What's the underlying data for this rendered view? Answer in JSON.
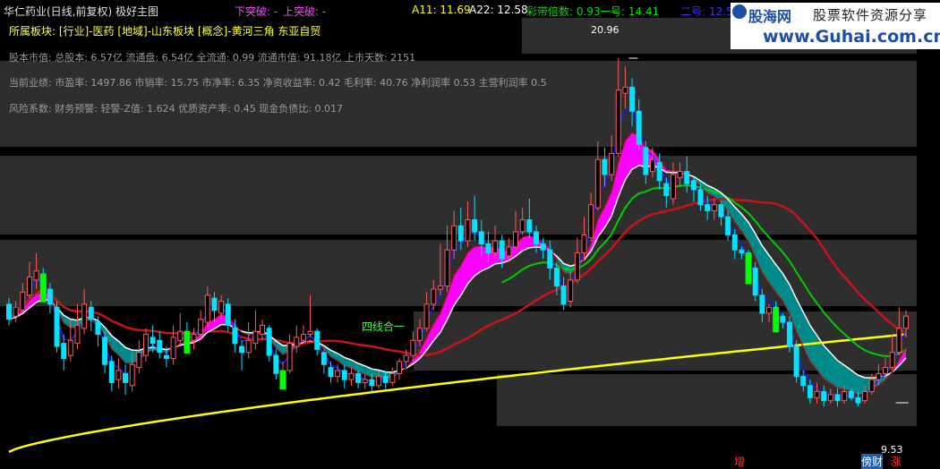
{
  "header": {
    "title": "华仁药业(日线,前复权) 极好主图",
    "break_down": "下突破: -",
    "break_up": "上突破: -",
    "a11": "A11: 11.69",
    "a22": "A22: 12.58",
    "band_mult": "彩带倍数: 0.93",
    "line1": "一号: 14.41",
    "line2": "二号: 12.53"
  },
  "info": {
    "sector": "所属板块: [行业]-医药 [地域]-山东板块 [概念]-黄河三角 东亚自贸",
    "market": "股本市值: 总股本: 6.57亿 流通盘: 6.54亿 全流通: 0.99 流通市值: 91.18亿 上市天数: 2151",
    "perf": "当前业绩: 市盈率: 1497.86 市销率: 15.75 市净率: 6.35 净资收益率: 0.42 毛利率: 40.76 净利润率 0.53 主营利润率 0.5",
    "risk": "风险系数: 财务预警: 轻警-Z值: 1.624 优质资产率: 0.45 现金负债比: 0.017"
  },
  "logo": {
    "name": "股海网",
    "slogan": "股票软件资源分享",
    "url": "www.Guhai.com.cn"
  },
  "annotations": {
    "high": "20.96",
    "low": "9.53",
    "four_lines": "四线合一",
    "zeng": "增",
    "bang": "傍财",
    "zhang": "涨"
  },
  "colors": {
    "up": "#ff5a5a",
    "down": "#00e4ff",
    "ma_fast": "#1a1aff",
    "ma_mid": "#c81414",
    "ma_long": "#ffff00",
    "ma_green": "#00cc00",
    "band_magenta": "#ff00ff",
    "band_teal": "#008b8b",
    "big_green": "#00ff00"
  },
  "candles": [
    [
      12.8,
      12.3,
      13.0,
      12.1
    ],
    [
      12.4,
      12.7,
      12.9,
      12.2
    ],
    [
      12.6,
      13.2,
      13.5,
      12.5
    ],
    [
      13.1,
      13.7,
      14.2,
      13.0
    ],
    [
      13.6,
      13.9,
      14.5,
      13.3
    ],
    [
      13.8,
      13.4,
      14.0,
      13.1
    ],
    [
      13.3,
      12.8,
      13.5,
      12.5
    ],
    [
      12.7,
      11.4,
      12.9,
      11.2
    ],
    [
      11.5,
      11.0,
      11.8,
      10.6
    ],
    [
      11.1,
      11.6,
      12.3,
      10.9
    ],
    [
      11.5,
      12.1,
      12.8,
      11.3
    ],
    [
      12.0,
      12.8,
      13.3,
      11.8
    ],
    [
      12.7,
      12.3,
      12.9,
      11.9
    ],
    [
      12.2,
      11.8,
      12.4,
      11.4
    ],
    [
      11.7,
      10.8,
      11.9,
      10.5
    ],
    [
      10.9,
      10.2,
      11.1,
      9.9
    ],
    [
      10.3,
      10.6,
      11.0,
      10.0
    ],
    [
      10.5,
      10.2,
      10.8,
      9.8
    ],
    [
      10.1,
      10.8,
      11.2,
      9.9
    ],
    [
      10.7,
      11.2,
      11.6,
      10.5
    ],
    [
      11.1,
      11.8,
      12.0,
      10.9
    ],
    [
      11.7,
      11.5,
      12.1,
      11.2
    ],
    [
      11.6,
      11.2,
      11.9,
      11.0
    ],
    [
      11.1,
      11.0,
      11.4,
      10.7
    ],
    [
      11.0,
      11.7,
      12.1,
      10.8
    ],
    [
      11.6,
      11.9,
      12.5,
      11.4
    ],
    [
      11.9,
      11.7,
      12.2,
      11.4
    ],
    [
      11.6,
      11.8,
      12.0,
      11.3
    ],
    [
      11.8,
      12.3,
      12.6,
      11.6
    ],
    [
      12.2,
      13.1,
      13.4,
      12.0
    ],
    [
      13.0,
      12.6,
      13.2,
      12.2
    ],
    [
      12.5,
      12.9,
      13.1,
      12.3
    ],
    [
      12.8,
      12.1,
      13.0,
      11.9
    ],
    [
      12.0,
      11.5,
      12.3,
      11.2
    ],
    [
      11.4,
      11.2,
      11.6,
      10.6
    ],
    [
      11.2,
      11.6,
      12.2,
      11.0
    ],
    [
      11.5,
      11.9,
      12.6,
      11.3
    ],
    [
      11.8,
      12.1,
      12.3,
      11.6
    ],
    [
      12.0,
      11.1,
      12.1,
      10.9
    ],
    [
      11.1,
      10.5,
      11.3,
      10.3
    ],
    [
      10.5,
      10.6,
      10.9,
      10.2
    ],
    [
      10.6,
      11.5,
      11.8,
      10.5
    ],
    [
      11.4,
      11.7,
      12.1,
      11.2
    ],
    [
      11.6,
      11.8,
      12.1,
      11.5
    ],
    [
      11.8,
      11.9,
      13.1,
      11.7
    ],
    [
      11.9,
      11.3,
      12.0,
      11.1
    ],
    [
      11.2,
      10.8,
      11.3,
      10.5
    ],
    [
      10.7,
      10.4,
      10.9,
      10.2
    ],
    [
      10.4,
      10.6,
      10.8,
      10.2
    ],
    [
      10.6,
      10.3,
      10.8,
      10.0
    ],
    [
      10.3,
      10.5,
      10.7,
      10.1
    ],
    [
      10.5,
      10.2,
      10.6,
      10.0
    ],
    [
      10.2,
      10.3,
      10.5,
      10.0
    ],
    [
      10.3,
      10.1,
      10.5,
      9.9
    ],
    [
      10.1,
      10.4,
      10.6,
      10.0
    ],
    [
      10.4,
      10.2,
      10.6,
      10.0
    ],
    [
      10.2,
      10.5,
      10.7,
      10.1
    ],
    [
      10.5,
      10.9,
      11.0,
      10.3
    ],
    [
      10.9,
      11.1,
      11.3,
      10.7
    ],
    [
      11.1,
      11.6,
      11.9,
      10.9
    ],
    [
      11.6,
      12.0,
      12.3,
      11.4
    ],
    [
      12.0,
      12.8,
      13.2,
      11.9
    ],
    [
      12.8,
      13.3,
      13.6,
      12.6
    ],
    [
      13.3,
      13.4,
      14.8,
      13.1
    ],
    [
      13.4,
      14.6,
      15.4,
      13.2
    ],
    [
      14.6,
      15.4,
      15.9,
      14.3
    ],
    [
      15.4,
      14.9,
      16.0,
      14.6
    ],
    [
      14.9,
      15.6,
      16.2,
      14.7
    ],
    [
      15.6,
      15.2,
      16.4,
      14.9
    ],
    [
      15.2,
      14.8,
      15.6,
      14.4
    ],
    [
      14.8,
      14.5,
      15.2,
      14.2
    ],
    [
      14.5,
      14.9,
      15.4,
      14.3
    ],
    [
      14.9,
      14.3,
      15.1,
      14.0
    ],
    [
      14.4,
      14.7,
      15.0,
      14.2
    ],
    [
      14.7,
      15.2,
      15.9,
      14.6
    ],
    [
      15.2,
      15.6,
      16.0,
      15.1
    ],
    [
      15.6,
      15.2,
      16.3,
      15.0
    ],
    [
      15.2,
      14.8,
      15.4,
      14.5
    ],
    [
      14.8,
      14.6,
      15.0,
      14.3
    ],
    [
      14.6,
      14.0,
      14.9,
      13.6
    ],
    [
      14.0,
      13.4,
      14.2,
      13.1
    ],
    [
      13.4,
      12.8,
      13.7,
      12.6
    ],
    [
      12.9,
      13.6,
      13.9,
      12.7
    ],
    [
      13.6,
      14.5,
      15.0,
      13.5
    ],
    [
      14.5,
      15.1,
      15.7,
      14.3
    ],
    [
      15.0,
      16.1,
      16.5,
      14.9
    ],
    [
      16.0,
      17.6,
      18.2,
      15.9
    ],
    [
      17.6,
      17.1,
      18.0,
      16.7
    ],
    [
      17.1,
      17.8,
      18.4,
      16.9
    ],
    [
      17.8,
      19.9,
      20.96,
      17.7
    ],
    [
      19.8,
      20.0,
      20.7,
      19.3
    ],
    [
      20.0,
      19.2,
      20.3,
      18.7
    ],
    [
      19.2,
      18.1,
      19.6,
      17.9
    ],
    [
      18.0,
      17.1,
      18.2,
      16.8
    ],
    [
      17.2,
      17.6,
      18.0,
      17.0
    ],
    [
      17.5,
      16.9,
      17.8,
      16.6
    ],
    [
      16.8,
      16.4,
      17.0,
      16.0
    ],
    [
      16.3,
      17.1,
      17.5,
      16.1
    ],
    [
      17.0,
      17.2,
      17.5,
      16.7
    ],
    [
      17.2,
      16.8,
      17.7,
      16.5
    ],
    [
      16.9,
      16.6,
      17.0,
      16.2
    ],
    [
      16.6,
      16.1,
      16.8,
      15.9
    ],
    [
      16.1,
      15.9,
      16.4,
      15.6
    ],
    [
      15.9,
      16.1,
      16.3,
      15.6
    ],
    [
      16.1,
      15.7,
      16.2,
      15.4
    ],
    [
      15.7,
      15.1,
      15.9,
      14.9
    ],
    [
      15.1,
      14.6,
      15.3,
      14.3
    ],
    [
      14.6,
      14.5,
      14.7,
      14.3
    ],
    [
      14.5,
      14.0,
      14.6,
      13.8
    ],
    [
      14.0,
      13.1,
      14.2,
      12.9
    ],
    [
      13.1,
      12.5,
      13.3,
      12.2
    ],
    [
      12.5,
      12.7,
      12.8,
      12.2
    ],
    [
      12.7,
      12.4,
      12.9,
      12.2
    ],
    [
      12.4,
      12.2,
      12.5,
      12.0
    ],
    [
      12.2,
      11.4,
      12.4,
      11.2
    ],
    [
      11.4,
      10.4,
      11.6,
      10.2
    ],
    [
      10.4,
      10.1,
      10.6,
      9.9
    ],
    [
      10.1,
      9.7,
      10.3,
      9.5
    ],
    [
      9.7,
      9.9,
      10.2,
      9.5
    ],
    [
      9.9,
      9.6,
      10.1,
      9.4
    ],
    [
      9.6,
      9.8,
      10.0,
      9.5
    ],
    [
      9.8,
      9.6,
      10.0,
      9.4
    ],
    [
      9.6,
      9.9,
      10.1,
      9.5
    ],
    [
      9.9,
      9.7,
      10.0,
      9.6
    ],
    [
      9.7,
      9.53,
      9.9,
      9.4
    ],
    [
      9.6,
      9.9,
      10.1,
      9.5
    ],
    [
      9.9,
      10.3,
      10.5,
      9.8
    ],
    [
      10.3,
      10.5,
      10.8,
      10.1
    ],
    [
      10.5,
      10.7,
      11.0,
      10.4
    ],
    [
      10.7,
      11.2,
      11.8,
      10.6
    ],
    [
      11.2,
      12.0,
      12.7,
      11.1
    ],
    [
      12.0,
      12.4,
      12.6,
      11.7
    ]
  ]
}
